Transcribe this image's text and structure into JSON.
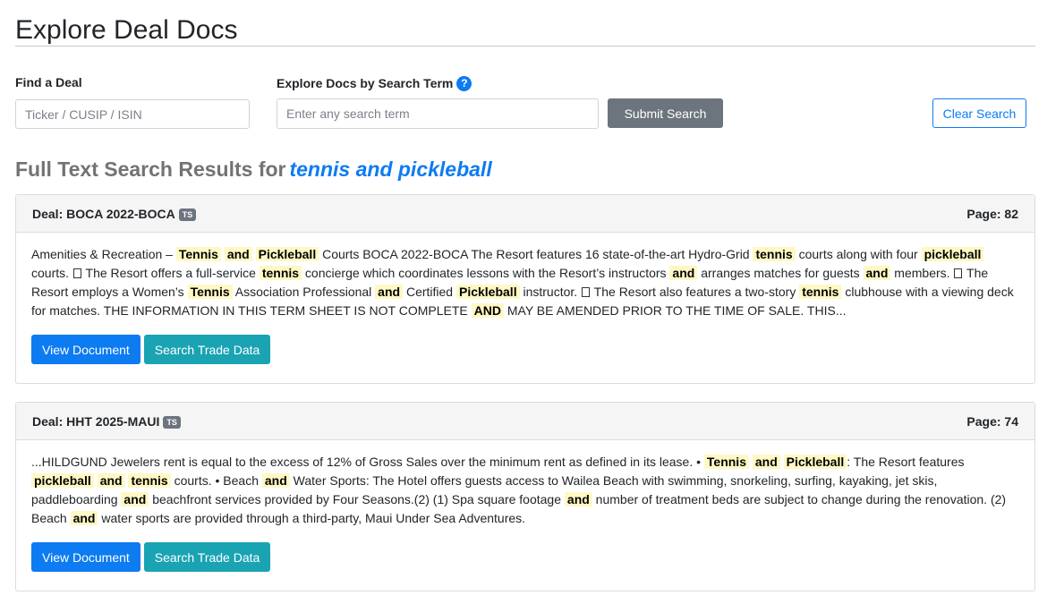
{
  "page": {
    "title": "Explore Deal Docs"
  },
  "find_deal": {
    "label": "Find a Deal",
    "placeholder": "Ticker / CUSIP / ISIN",
    "value": ""
  },
  "search": {
    "label": "Explore Docs by Search Term",
    "help_icon": "?",
    "placeholder": "Enter any search term",
    "value": "",
    "submit_label": "Submit Search",
    "clear_label": "Clear Search"
  },
  "results": {
    "heading_prefix": "Full Text Search Results for",
    "term": "tennis and pickleball",
    "cards": [
      {
        "deal_label": "Deal: BOCA 2022-BOCA",
        "badge": "TS",
        "page_label": "Page: 82",
        "snippet": [
          {
            "t": "Amenities & Recreation – "
          },
          {
            "t": "Tennis",
            "hl": true
          },
          {
            "t": " "
          },
          {
            "t": "and",
            "hl": true
          },
          {
            "t": " "
          },
          {
            "t": "Pickleball",
            "hl": true
          },
          {
            "t": " Courts BOCA 2022-BOCA The Resort features 16 state-of-the-art Hydro-Grid "
          },
          {
            "t": "tennis",
            "hl": true
          },
          {
            "t": " courts along with four "
          },
          {
            "t": "pickleball",
            "hl": true
          },
          {
            "t": " courts. "
          },
          {
            "box": true
          },
          {
            "t": " The Resort offers a full-service "
          },
          {
            "t": "tennis",
            "hl": true
          },
          {
            "t": " concierge which coordinates lessons with the Resort’s instructors "
          },
          {
            "t": "and",
            "hl": true
          },
          {
            "t": " arranges matches for guests "
          },
          {
            "t": "and",
            "hl": true
          },
          {
            "t": " members. "
          },
          {
            "box": true
          },
          {
            "t": " The Resort employs a Women’s "
          },
          {
            "t": "Tennis",
            "hl": true
          },
          {
            "t": " Association Professional "
          },
          {
            "t": "and",
            "hl": true
          },
          {
            "t": " Certified "
          },
          {
            "t": "Pickleball",
            "hl": true
          },
          {
            "t": " instructor. "
          },
          {
            "box": true
          },
          {
            "t": " The Resort also features a two-story "
          },
          {
            "t": "tennis",
            "hl": true
          },
          {
            "t": " clubhouse with a viewing deck for matches. THE INFORMATION IN THIS TERM SHEET IS NOT COMPLETE "
          },
          {
            "t": "AND",
            "hl": true
          },
          {
            "t": " MAY BE AMENDED PRIOR TO THE TIME OF SALE. THIS..."
          }
        ],
        "view_label": "View Document",
        "trade_label": "Search Trade Data"
      },
      {
        "deal_label": "Deal: HHT 2025-MAUI",
        "badge": "TS",
        "page_label": "Page: 74",
        "snippet": [
          {
            "t": "...HILDGUND Jewelers rent is equal to the excess of 12% of Gross Sales over the minimum rent as defined in its lease. • "
          },
          {
            "t": "Tennis",
            "hl": true
          },
          {
            "t": " "
          },
          {
            "t": "and",
            "hl": true
          },
          {
            "t": " "
          },
          {
            "t": "Pickleball",
            "hl": true
          },
          {
            "t": ": The Resort features "
          },
          {
            "t": "pickleball",
            "hl": true
          },
          {
            "t": " "
          },
          {
            "t": "and",
            "hl": true
          },
          {
            "t": " "
          },
          {
            "t": "tennis",
            "hl": true
          },
          {
            "t": " courts. • Beach "
          },
          {
            "t": "and",
            "hl": true
          },
          {
            "t": " Water Sports: The Hotel offers guests access to Wailea Beach with swimming, snorkeling, surfing, kayaking, jet skis, paddleboarding "
          },
          {
            "t": "and",
            "hl": true
          },
          {
            "t": " beachfront services provided by Four Seasons.(2) (1) Spa square footage "
          },
          {
            "t": "and",
            "hl": true
          },
          {
            "t": " number of treatment beds are subject to change during the renovation. (2) Beach "
          },
          {
            "t": "and",
            "hl": true
          },
          {
            "t": " water sports are provided through a third-party, Maui Under Sea Adventures."
          }
        ],
        "view_label": "View Document",
        "trade_label": "Search Trade Data"
      }
    ]
  },
  "colors": {
    "primary": "#0d7bf2",
    "secondary": "#6c757d",
    "info": "#1aa3b3",
    "highlight": "#fff8c4"
  }
}
